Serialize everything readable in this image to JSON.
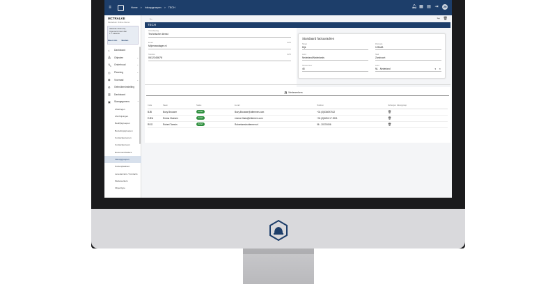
{
  "topbar": {
    "menu_icon": "menu-icon",
    "breadcrumbs": [
      "Home",
      ">",
      "Inkoopgroepen",
      ">",
      "TECH"
    ],
    "icons": [
      "bell-icon",
      "calendar-icon",
      "clipboard-icon",
      "logout-icon"
    ],
    "avatar": "JM",
    "color": "#1d3e6a"
  },
  "sidebar": {
    "company": "MCTRALKE",
    "subtitle": "Modellum Online Demo",
    "notice_lines": [
      "Vakantie Online bij",
      "Ingevoerd meer dan",
      "1.7 vakantie"
    ],
    "buttons": [
      "Meer info",
      "Sluiten"
    ],
    "nav": [
      {
        "label": "Dashboard",
        "icon": "home-icon",
        "chevron": ""
      },
      {
        "label": "Objecten",
        "icon": "objects-icon",
        "chevron": "⌄"
      },
      {
        "label": "Onderhoud",
        "icon": "wrench-icon",
        "chevron": "⌄"
      },
      {
        "label": "Planning",
        "icon": "planning-icon",
        "chevron": "⌄"
      },
      {
        "label": "Voorraad",
        "icon": "stock-icon",
        "chevron": "⌄"
      },
      {
        "label": "Gebruikersinstelling",
        "icon": "settings-icon",
        "chevron": ""
      },
      {
        "label": "Dashboard",
        "icon": "chart-icon",
        "chevron": ""
      },
      {
        "label": "Stamgegevens",
        "icon": "data-icon",
        "chevron": "^"
      }
    ],
    "sub_nav": [
      "Afdelingen",
      "Afschrijvingen",
      "Bedrijfsgroepen",
      "Bestelingsgroepen",
      "Contactpersonen",
      "Contactpersoon",
      "Document/folders",
      "Inkoopgroepen",
      "Kostenplaatsen",
      "Leveranciers / Contacts",
      "Medewerkers",
      "Objecttype"
    ],
    "active_sub": 7
  },
  "page": {
    "title": "TECH",
    "fields": [
      {
        "label": "Omschrijving",
        "value": "Technische dienst",
        "count": ""
      },
      {
        "label": "Email",
        "value": "Mijnmandager.nl",
        "count": "0/255"
      },
      {
        "label": "Telefoon",
        "value": "0612345678",
        "count": "0/255"
      }
    ],
    "card": {
      "title": "Standaard factuuradres",
      "fields": [
        {
          "label": "Straat",
          "value": "Dijk"
        },
        {
          "label": "Postcode",
          "value": "1234AB"
        },
        {
          "label": "Land",
          "value": "Nederland/Nederlands"
        },
        {
          "label": "Stad",
          "value": "Zandvoort"
        },
        {
          "label": "Huisnummer",
          "value": "48"
        },
        {
          "label": "Land",
          "value": "NL - Nederland"
        }
      ]
    },
    "tab_label": "Medewerkers",
    "table": {
      "headers": [
        "Code",
        "Naam",
        "Status",
        "E-mail",
        "Telefoon",
        "Verbergen Inkoopgroep"
      ],
      "rows": [
        [
          "BJB",
          "Bozy Brouwer",
          "Actief",
          "Bozy.Brouwer@ottermen.com",
          "+31 (0)634097512",
          "trash-icon"
        ],
        [
          "EJEA",
          "Emma Claesen",
          "Actief",
          "emma.Claes@ettermen.com",
          "+31 (0)6261 17 2021",
          "trash-icon"
        ],
        [
          "ROO",
          "Robert Tamsin",
          "Actief",
          "Robertamsinottermen.nl",
          "06 - 20274006",
          "trash-icon"
        ]
      ]
    },
    "fab_label": "+",
    "badge_color": "#2e8f3e",
    "fab_color": "#ee4b35"
  }
}
